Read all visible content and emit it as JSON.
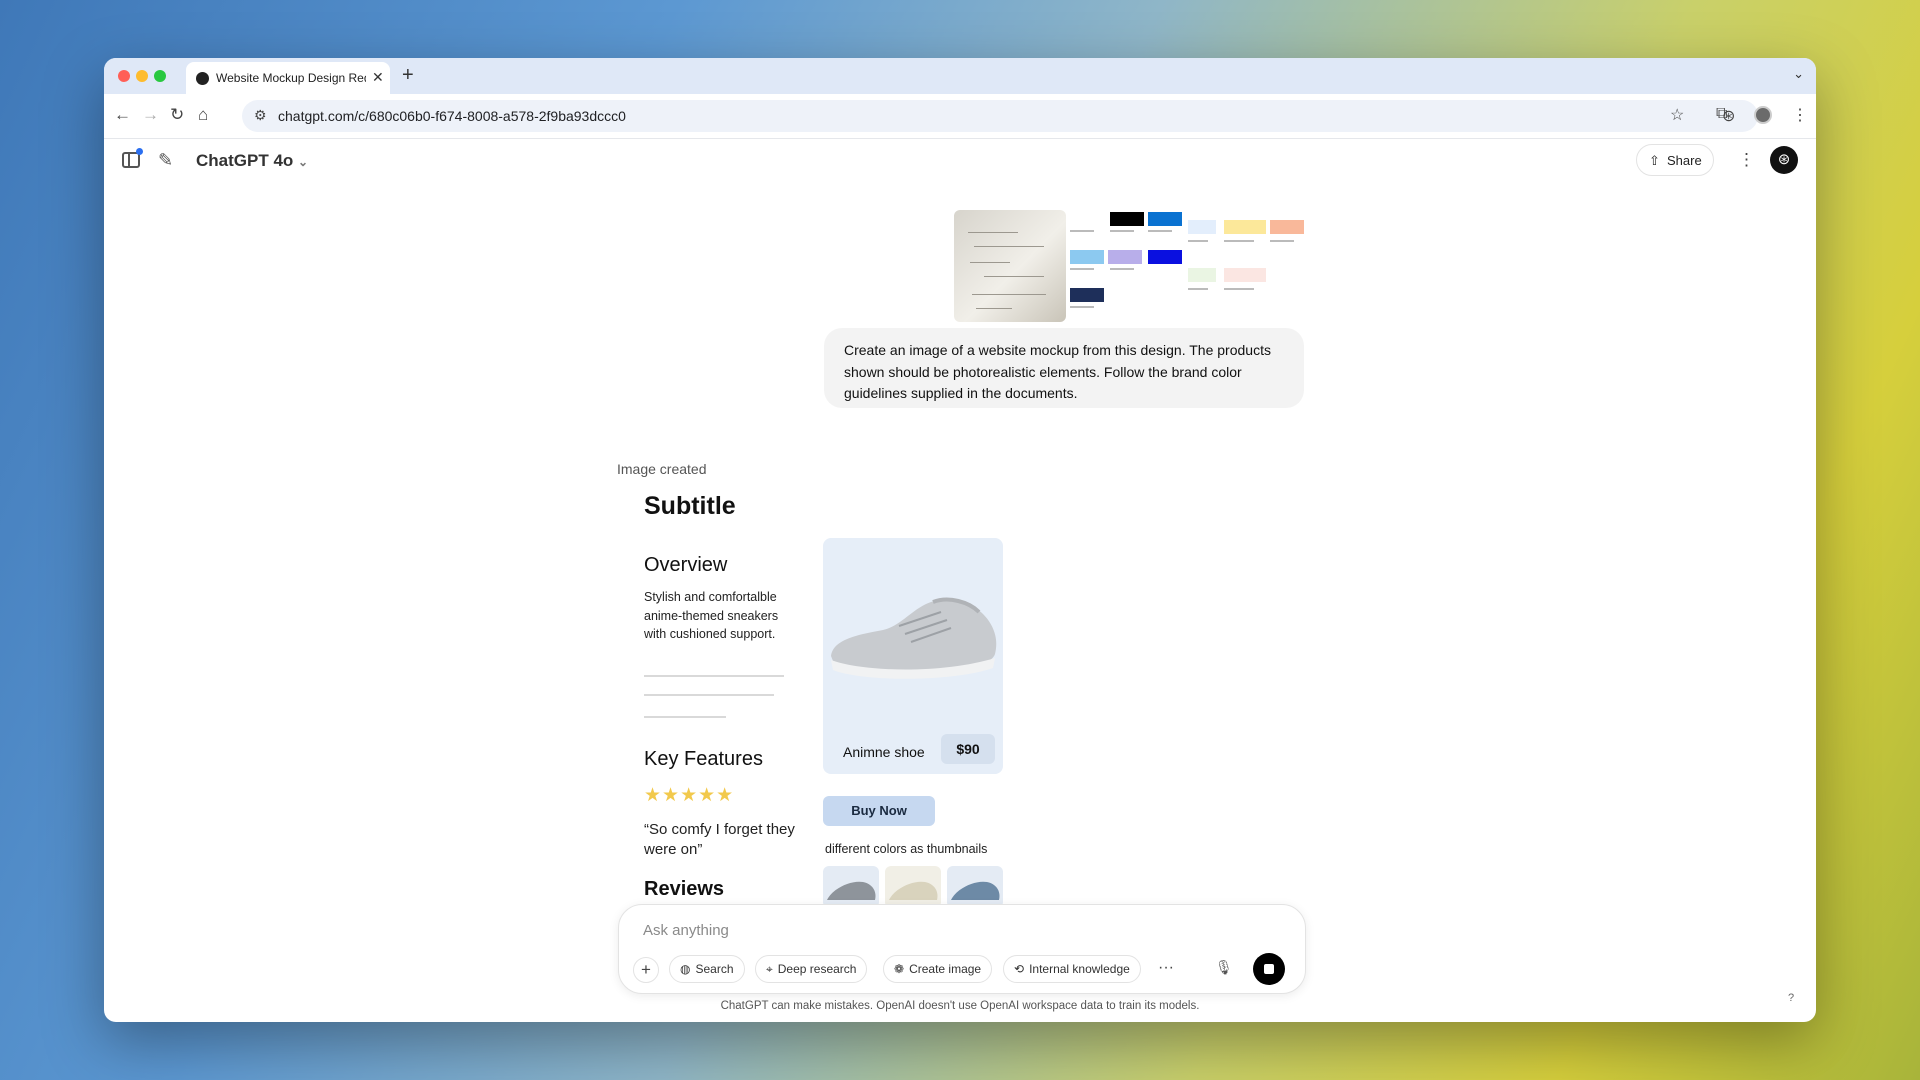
{
  "browser": {
    "tab_title": "Website Mockup Design Req",
    "url": "chatgpt.com/c/680c06b0-f674-8008-a578-2f9ba93dccc0"
  },
  "header": {
    "model_label": "ChatGPT 4o",
    "share_label": "Share"
  },
  "user_message": {
    "text": "Create an image of a website mockup from this design. The products shown should be photorealistic elements. Follow the brand color guidelines supplied in the documents."
  },
  "assistant": {
    "status": "Image created",
    "mockup": {
      "subtitle": "Subtitle",
      "overview_heading": "Overview",
      "overview_text": "Stylish and comfortalble anime-themed sneakers with cushioned support.",
      "features_heading": "Key Features",
      "rating_stars": 5,
      "stars_glyphs": "★★★★★",
      "quote": "“So comfy I forget they were on”",
      "reviews_heading": "Reviews",
      "product_name": "Animne shoe",
      "price": "$90",
      "buy_label": "Buy Now",
      "thumbnails_label": "different colors as thumbnails"
    }
  },
  "composer": {
    "placeholder": "Ask anything",
    "buttons": {
      "search": "Search",
      "deep_research": "Deep research",
      "create_image": "Create image",
      "internal_knowledge": "Internal knowledge"
    }
  },
  "footer": {
    "disclaimer": "ChatGPT can make mistakes. OpenAI doesn't use OpenAI workspace data to train its models.",
    "help": "?"
  },
  "colors": {
    "swatches": [
      "#000000",
      "#0a72d1",
      "#e3eefc",
      "#fce89a",
      "#f9b89a",
      "#8cc9f0",
      "#b8aeea",
      "#0a10e0",
      "#eaf5e3",
      "#fbe6e2",
      "#1e2f5a"
    ],
    "card_bg": "#e6eef8",
    "buy_bg": "#c6d8f0",
    "star": "#f2c94c"
  },
  "icons": [
    "back-icon",
    "forward-icon",
    "reload-icon",
    "home-icon",
    "site-settings-icon",
    "openai-extension-icon",
    "star-icon",
    "extensions-icon",
    "profile-icon",
    "menu-icon",
    "sidebar-icon",
    "compose-icon",
    "chevron-down-icon",
    "share-icon",
    "more-icon",
    "openai-logo-icon",
    "plus-icon",
    "globe-icon",
    "telescope-icon",
    "image-icon",
    "knowledge-icon",
    "microphone-icon",
    "stop-icon",
    "arrow-down-icon"
  ]
}
